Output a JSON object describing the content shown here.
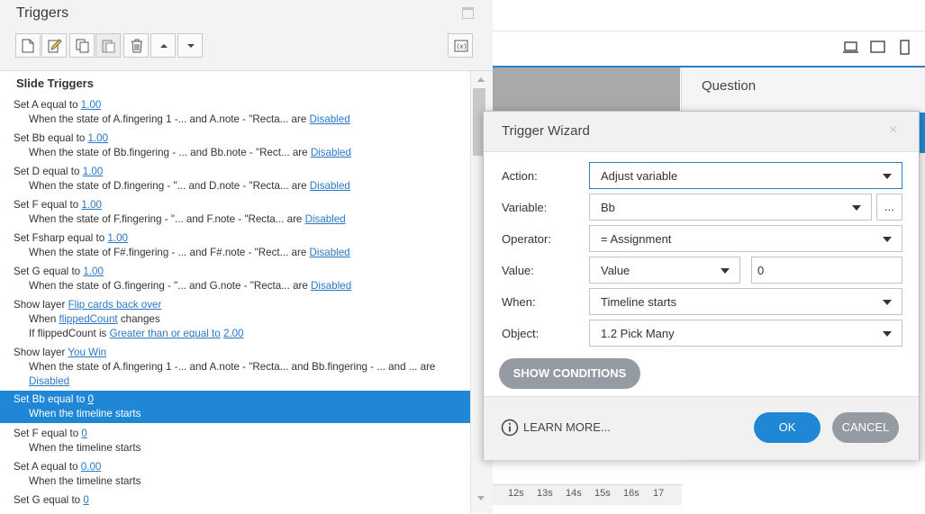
{
  "triggers": {
    "title": "Triggers",
    "section_title": "Slide Triggers",
    "items": [
      {
        "l1a": "Set A equal to ",
        "l1link": "1.00",
        "l2a": "When the state of A.fingering 1 -... and A.note - \"Recta... are ",
        "l2link": "Disabled"
      },
      {
        "l1a": "Set Bb equal to ",
        "l1link": "1.00",
        "l2a": "When the state of Bb.fingering - ... and Bb.note - \"Rect... are ",
        "l2link": "Disabled"
      },
      {
        "l1a": "Set D equal to ",
        "l1link": "1.00",
        "l2a": "When the state of D.fingering - \"... and D.note - \"Recta... are ",
        "l2link": "Disabled"
      },
      {
        "l1a": "Set F equal to ",
        "l1link": "1.00",
        "l2a": "When the state of F.fingering - \"... and F.note - \"Recta... are ",
        "l2link": "Disabled"
      },
      {
        "l1a": "Set Fsharp equal to ",
        "l1link": "1.00",
        "l2a": "When the state of F#.fingering - ... and F#.note - \"Rect... are ",
        "l2link": "Disabled"
      },
      {
        "l1a": "Set G equal to ",
        "l1link": "1.00",
        "l2a": "When the state of G.fingering - \"... and G.note - \"Recta... are ",
        "l2link": "Disabled"
      }
    ],
    "flip": {
      "l1a": "Show layer ",
      "l1link": "Flip cards back over",
      "l2a": "When ",
      "l2link": "flippedCount",
      "l2b": " changes",
      "l3a": "If flippedCount is ",
      "l3link": "Greater than or equal to",
      "l3b": " ",
      "l3link2": "2.00"
    },
    "win": {
      "l1a": "Show layer ",
      "l1link": "You Win",
      "l2": "When the state of A.fingering 1 -... and A.note - \"Recta... and Bb.fingering - ... and ... are",
      "l3link": "Disabled"
    },
    "timeline_items": [
      {
        "l1a": "Set Bb equal to ",
        "l1link": "0",
        "l2": "When the timeline starts"
      },
      {
        "l1a": "Set F equal to ",
        "l1link": "0",
        "l2": "When the timeline starts"
      },
      {
        "l1a": "Set A equal to ",
        "l1link": "0.00",
        "l2": "When the timeline starts"
      },
      {
        "l1a": "Set G equal to ",
        "l1link": "0"
      }
    ]
  },
  "background": {
    "question_label": "Question",
    "timeline_ticks": [
      "12s",
      "13s",
      "14s",
      "15s",
      "16s",
      "17"
    ]
  },
  "wizard": {
    "title": "Trigger Wizard",
    "close": "×",
    "labels": {
      "action": "Action:",
      "variable": "Variable:",
      "operator": "Operator:",
      "value": "Value:",
      "when": "When:",
      "object": "Object:"
    },
    "values": {
      "action": "Adjust variable",
      "variable": "Bb",
      "operator": "= Assignment",
      "value_type": "Value",
      "value": "0",
      "when": "Timeline starts",
      "object": "1.2 Pick Many"
    },
    "ellipsis": "...",
    "show_conditions": "SHOW CONDITIONS",
    "learn_more": "LEARN MORE...",
    "ok": "OK",
    "cancel": "CANCEL",
    "accent": "#1f87d5"
  }
}
